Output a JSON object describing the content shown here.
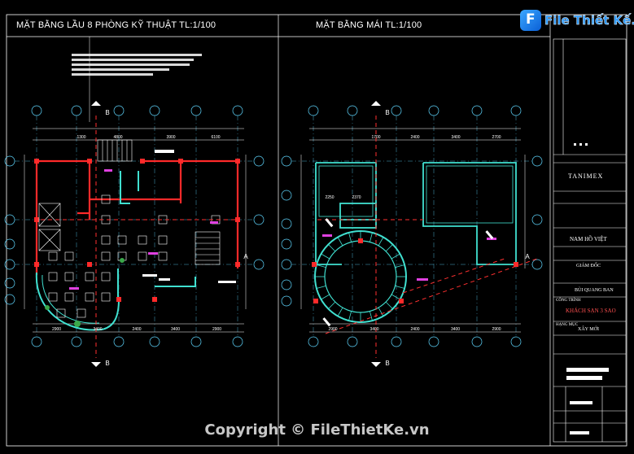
{
  "titles": {
    "left_plan": "MẶT BẰNG LẦU 8 PHÒNG KỸ THUẬT TL:1/100",
    "right_plan": "MẶT BẰNG MÁI TL:1/100"
  },
  "watermark": {
    "logo_text": "File Thiết Kế.vn",
    "copyright": "Copyright © FileThietKe.vn"
  },
  "title_block": {
    "company": "TANIMEX",
    "partner": "NAM HỒ VIỆT",
    "director": "GIÁM ĐỐC",
    "designer": "BÙI QUANG BAN",
    "project_label": "CÔNG TRÌNH",
    "project": "KHÁCH SẠN 3 SAO",
    "category_label": "HẠNG MỤC",
    "category": "XÂY MỚI"
  },
  "dimensions": {
    "left_bottom": [
      "2900",
      "3400",
      "2400",
      "3400",
      "2900"
    ],
    "left_top": [
      "1300",
      "4800",
      "3900",
      "6100"
    ],
    "right_bottom": [
      "2900",
      "3400",
      "2400",
      "3400",
      "2900"
    ],
    "right_top": [
      "1700",
      "2400",
      "3400",
      "2700"
    ],
    "right_inner": [
      "2250",
      "2370"
    ]
  },
  "grid_labels": {
    "axis_a": "A",
    "axis_b": "B"
  },
  "colors": {
    "background": "#000000",
    "grid": "#5fd7ff",
    "wall": "#ff2a2a",
    "roof": "#40e0d0",
    "dashed": "#ff3030",
    "text": "#ffffff",
    "magenta": "#e040e0"
  }
}
